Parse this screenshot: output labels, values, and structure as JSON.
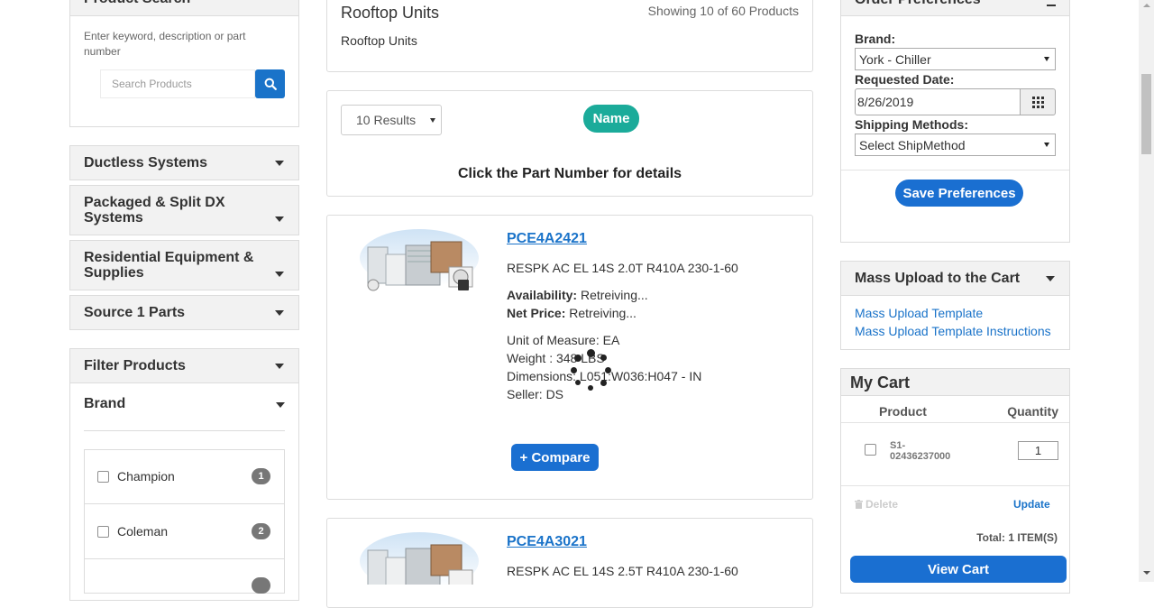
{
  "left": {
    "product_search": {
      "title": "Product Search",
      "hint": "Enter keyword, description or part number",
      "placeholder": "Search Products"
    },
    "categories": [
      {
        "label": "Ductless Systems"
      },
      {
        "label": "Packaged & Split DX Systems"
      },
      {
        "label": "Residential Equipment & Supplies"
      },
      {
        "label": "Source 1 Parts"
      }
    ],
    "filter_title": "Filter Products",
    "brand_title": "Brand",
    "brands": [
      {
        "label": "Champion",
        "count": "1"
      },
      {
        "label": "Coleman",
        "count": "2"
      }
    ]
  },
  "center": {
    "category_title": "Rooftop Units",
    "category_sub": "Rooftop Units",
    "showing": "Showing 10 of 60 Products",
    "results_select": "10 Results",
    "sort_pill": "Name",
    "instructions": "Click the Part Number for details",
    "products": [
      {
        "part": "PCE4A2421",
        "desc": "RESPK AC EL 14S 2.0T R410A 230-1-60",
        "availability_label": "Availability:",
        "availability": "Retreiving...",
        "price_label": "Net Price:",
        "price": "Retreiving...",
        "uom": "Unit of Measure: EA",
        "weight": "Weight : 348 LBS",
        "dimensions": "Dimensions: L051:W036:H047 - IN",
        "seller": "Seller: DS",
        "compare": "+ Compare"
      },
      {
        "part": "PCE4A3021",
        "desc": "RESPK AC EL 14S 2.5T R410A 230-1-60"
      }
    ]
  },
  "right": {
    "order_prefs": {
      "title": "Order Preferences",
      "brand_label": "Brand:",
      "brand_value": "York - Chiller",
      "date_label": "Requested Date:",
      "date_value": "8/26/2019",
      "ship_label": "Shipping Methods:",
      "ship_value": "Select ShipMethod",
      "save_label": "Save Preferences"
    },
    "mass_upload": {
      "title": "Mass Upload to the Cart",
      "link1": "Mass Upload Template",
      "link2": "Mass Upload Template Instructions"
    },
    "cart": {
      "title": "My Cart",
      "col_product": "Product",
      "col_qty": "Quantity",
      "item_line1": "S1-",
      "item_line2": "02436237000",
      "item_qty": "1",
      "delete_label": "Delete",
      "update_label": "Update",
      "total": "Total: 1 ITEM(S)",
      "view_cart": "View Cart"
    }
  },
  "colors": {
    "primary_blue": "#1a6fd1",
    "teal": "#1bab9a",
    "panel_header": "#f2f2f2"
  }
}
